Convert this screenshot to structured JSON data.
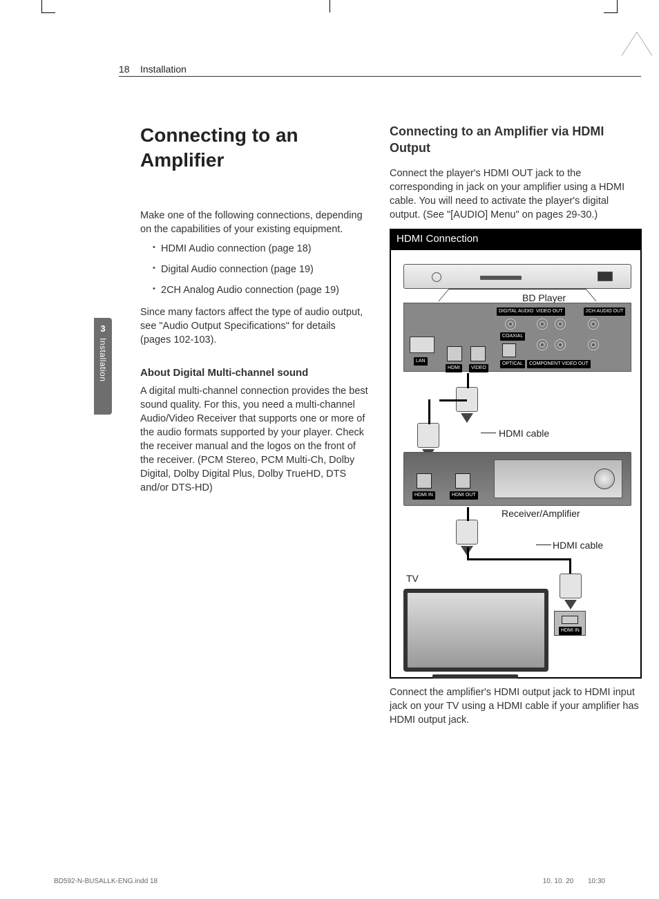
{
  "header": {
    "page_number": "18",
    "section": "Installation"
  },
  "side_tab": {
    "number": "3",
    "label": "Installation"
  },
  "left": {
    "title": "Connecting to an Amplifier",
    "intro": "Make one of the following connections, depending on the capabilities of your existing equipment.",
    "bullets": [
      "HDMI Audio connection (page 18)",
      "Digital Audio connection (page 19)",
      "2CH Analog Audio connection (page 19)"
    ],
    "note": "Since many factors affect the type of audio output, see \"Audio Output Specifications\" for details (pages 102-103).",
    "subhead": "About Digital Multi-channel sound",
    "subbody": "A digital multi-channel connection provides the best sound quality. For this, you need a multi-channel Audio/Video Receiver that supports one or more of the audio formats supported by your player. Check the receiver manual and the logos on the front of the receiver. (PCM Stereo, PCM Multi-Ch, Dolby Digital, Dolby Digital Plus, Dolby TrueHD, DTS and/or DTS-HD)"
  },
  "right": {
    "title": "Connecting to an Amplifier via HDMI Output",
    "intro": "Connect the player's HDMI OUT jack to the corresponding in jack on your amplifier using a HDMI cable. You will need to activate the player's digital output. (See \"[AUDIO] Menu\" on pages 29-30.)",
    "diagram_title": "HDMI Connection",
    "labels": {
      "bd_player": "BD Player",
      "hdmi_cable_1": "HDMI cable",
      "receiver": "Receiver/Amplifier",
      "hdmi_cable_2": "HDMI cable",
      "tv": "TV"
    },
    "ports": {
      "lan": "LAN",
      "hdmi": "HDMI",
      "video": "VIDEO",
      "digital_audio_out": "DIGITAL AUDIO OUT",
      "coaxial": "COAXIAL",
      "optical": "OPTICAL",
      "video_out": "VIDEO OUT",
      "component": "COMPONENT VIDEO OUT",
      "twoch": "2CH AUDIO OUT",
      "hdmi_in": "HDMI IN",
      "hdmi_out": "HDMI OUT"
    },
    "outro": "Connect the amplifier's HDMI output jack to HDMI input jack on your TV using a HDMI cable if your amplifier has HDMI output jack."
  },
  "footer": {
    "file": "BD592-N-BUSALLK-ENG.indd   18",
    "date": "10. 10. 20",
    "time": "10:30"
  }
}
